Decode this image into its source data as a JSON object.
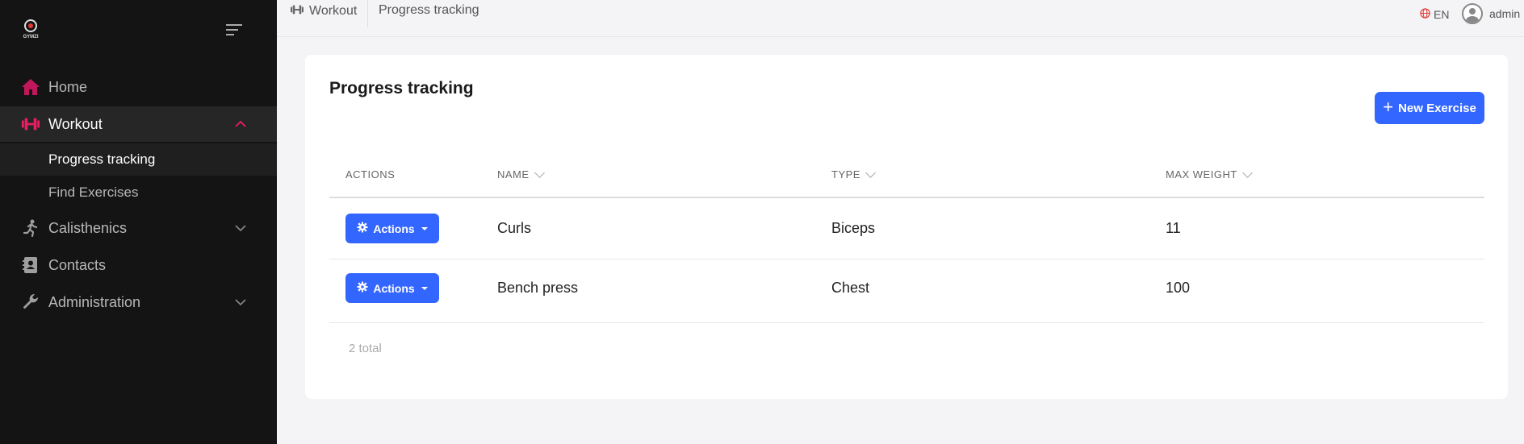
{
  "brand": {
    "logo_text": "GYMZI"
  },
  "sidebar": {
    "items": [
      {
        "label": "Home",
        "icon": "home-icon"
      },
      {
        "label": "Workout",
        "icon": "dumbbell-icon",
        "expanded": true,
        "children": [
          {
            "label": "Progress tracking",
            "active": true
          },
          {
            "label": "Find Exercises"
          }
        ]
      },
      {
        "label": "Calisthenics",
        "icon": "running-icon",
        "expanded": false
      },
      {
        "label": "Contacts",
        "icon": "contact-book-icon"
      },
      {
        "label": "Administration",
        "icon": "wrench-icon",
        "expanded": false
      }
    ]
  },
  "topbar": {
    "breadcrumb": [
      "Workout",
      "Progress tracking"
    ],
    "language": "EN",
    "user": "admin"
  },
  "main": {
    "title": "Progress tracking",
    "new_button_label": "New Exercise",
    "table": {
      "columns": [
        "ACTIONS",
        "NAME",
        "TYPE",
        "MAX WEIGHT"
      ],
      "action_label": "Actions",
      "rows": [
        {
          "name": "Curls",
          "type": "Biceps",
          "max_weight": "11"
        },
        {
          "name": "Bench press",
          "type": "Chest",
          "max_weight": "100"
        }
      ]
    },
    "total": "2 total"
  },
  "colors": {
    "sidebar_bg": "#141414",
    "accent_pink": "#e91e63",
    "home_icon": "#c2185b",
    "primary_button": "#3366ff",
    "page_bg": "#f4f4f6"
  }
}
